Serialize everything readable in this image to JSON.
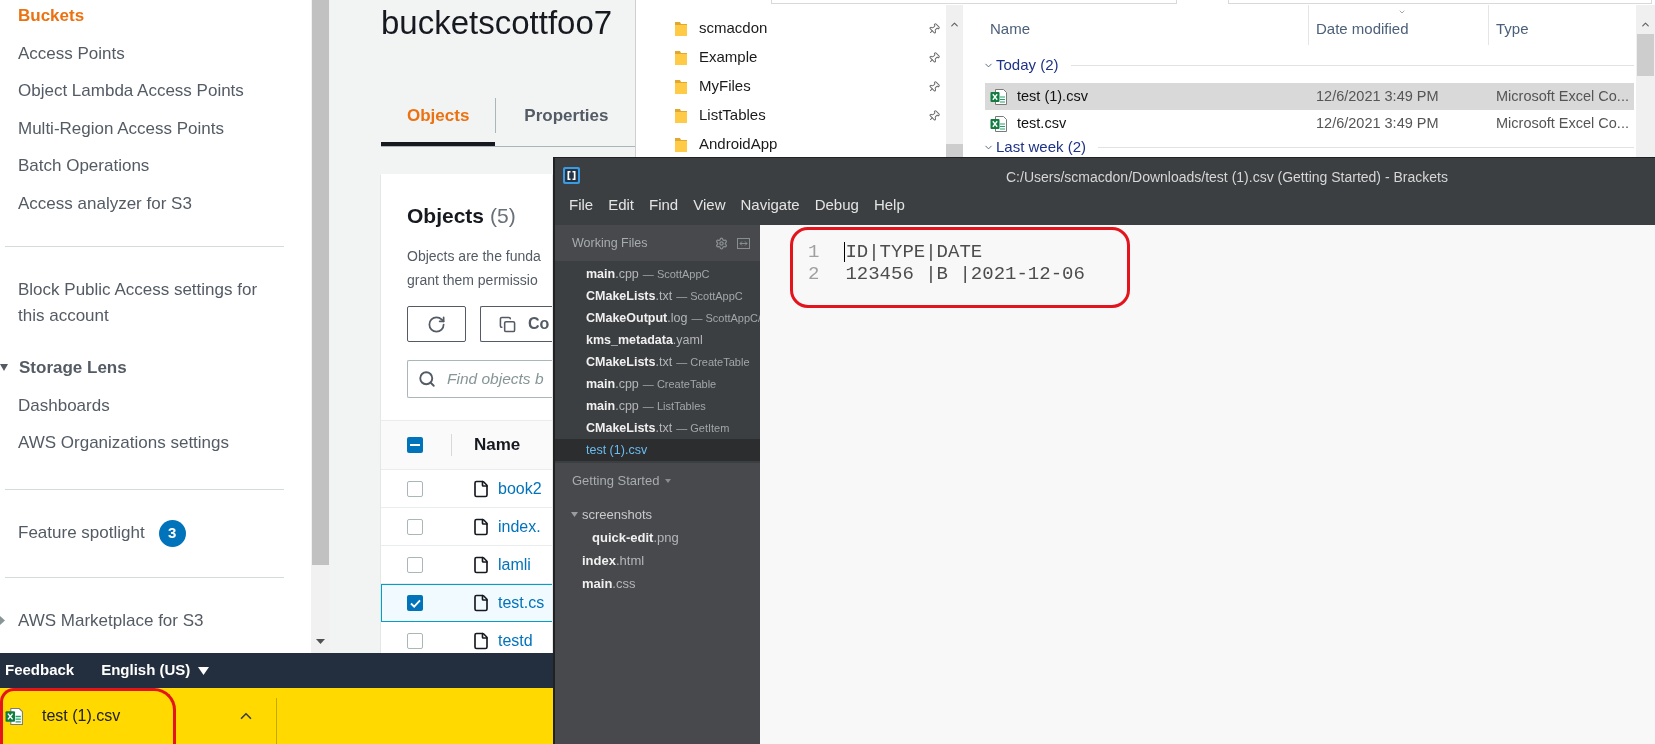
{
  "s3_sidebar": {
    "sections": [
      {
        "items": [
          {
            "kind": "link",
            "label": "Buckets",
            "selected": true
          },
          {
            "kind": "link",
            "label": "Access Points",
            "selected": false
          },
          {
            "kind": "link",
            "label": "Object Lambda Access Points",
            "selected": false
          },
          {
            "kind": "link",
            "label": "Multi-Region Access Points",
            "selected": false
          },
          {
            "kind": "link",
            "label": "Batch Operations",
            "selected": false
          },
          {
            "kind": "link",
            "label": "Access analyzer for S3",
            "selected": false
          }
        ]
      },
      {
        "items": [
          {
            "kind": "link",
            "label": "Block Public Access settings for this account",
            "selected": false
          },
          {
            "kind": "group",
            "label": "Storage Lens",
            "expanded": true,
            "items": [
              {
                "kind": "link",
                "label": "Dashboards",
                "selected": false
              },
              {
                "kind": "link",
                "label": "AWS Organizations settings",
                "selected": false
              }
            ]
          }
        ]
      },
      {
        "items": [
          {
            "kind": "link",
            "label": "Feature spotlight",
            "selected": false,
            "badge": "3"
          }
        ]
      },
      {
        "items": [
          {
            "kind": "group",
            "label": "AWS Marketplace for S3",
            "expanded": false
          }
        ]
      }
    ]
  },
  "bucket_page": {
    "title": "bucketscottfoo7",
    "tabs": [
      {
        "label": "Objects",
        "selected": true
      },
      {
        "label": "Properties",
        "selected": false
      }
    ],
    "objects_panel": {
      "title": "Objects",
      "count": "(5)",
      "description_lines": [
        "Objects are the funda",
        "grant them permissio"
      ],
      "copy_button": "Co",
      "search": {
        "placeholder": "Find objects b"
      },
      "select_all": {
        "indeterminate": true
      },
      "columns": [
        "Name"
      ],
      "rows": [
        {
          "name": "book2",
          "selected": false
        },
        {
          "name": "index.",
          "selected": false
        },
        {
          "name": "lamli",
          "selected": false
        },
        {
          "name": "test.cs",
          "selected": true
        },
        {
          "name": "testd",
          "selected": false
        }
      ]
    }
  },
  "footer": {
    "feedback": "Feedback",
    "language": "English (US)"
  },
  "download_bar": {
    "file": "test (1).csv"
  },
  "file_explorer": {
    "quick_access": [
      {
        "name": "scmacdon",
        "pinned": true
      },
      {
        "name": "Example",
        "pinned": true
      },
      {
        "name": "MyFiles",
        "pinned": true
      },
      {
        "name": "ListTables",
        "pinned": true
      },
      {
        "name": "AndroidApp",
        "pinned": false
      }
    ],
    "columns": [
      {
        "label": "Name",
        "sorted": false
      },
      {
        "label": "Date modified",
        "sorted": true
      },
      {
        "label": "Type",
        "sorted": false
      }
    ],
    "groups": [
      {
        "label": "Today (2)",
        "expanded": true,
        "files": [
          {
            "name": "test (1).csv",
            "date": "12/6/2021 3:49 PM",
            "type": "Microsoft Excel Co...",
            "selected": true
          },
          {
            "name": "test.csv",
            "date": "12/6/2021 3:49 PM",
            "type": "Microsoft Excel Co...",
            "selected": false
          }
        ]
      },
      {
        "label": "Last week (2)",
        "expanded": true
      }
    ]
  },
  "brackets": {
    "title": "C:/Users/scmacdon/Downloads/test (1).csv (Getting Started) - Brackets",
    "menu": [
      "File",
      "Edit",
      "Find",
      "View",
      "Navigate",
      "Debug",
      "Help"
    ],
    "working_files": {
      "title": "Working Files",
      "files": [
        {
          "name": "main",
          "ext": ".cpp",
          "dir": "— ScottAppC",
          "selected": false
        },
        {
          "name": "CMakeLists",
          "ext": ".txt",
          "dir": "— ScottAppC",
          "selected": false
        },
        {
          "name": "CMakeOutput",
          "ext": ".log",
          "dir": "— ScottAppC/",
          "selected": false
        },
        {
          "name": "kms_metadata",
          "ext": ".yaml",
          "selected": false
        },
        {
          "name": "CMakeLists",
          "ext": ".txt",
          "dir": "— CreateTable",
          "selected": false
        },
        {
          "name": "main",
          "ext": ".cpp",
          "dir": "— CreateTable",
          "selected": false
        },
        {
          "name": "main",
          "ext": ".cpp",
          "dir": "— ListTables",
          "selected": false
        },
        {
          "name": "CMakeLists",
          "ext": ".txt",
          "dir": "— GetItem",
          "selected": false
        },
        {
          "name": "test (1)",
          "ext": ".csv",
          "selected": true
        }
      ]
    },
    "project": {
      "title": "Getting Started",
      "tree": [
        {
          "name": "screenshots",
          "expanded": true,
          "children": [
            {
              "name": "quick-edit",
              "ext": ".png"
            }
          ]
        },
        {
          "name": "index",
          "ext": ".html"
        },
        {
          "name": "main",
          "ext": ".css"
        }
      ]
    },
    "editor": {
      "lines": [
        {
          "number": "1",
          "text": "ID|TYPE|DATE",
          "cursor": true
        },
        {
          "number": "2",
          "text": "123456 |B |2021-12-06",
          "cursor": false
        }
      ]
    }
  }
}
